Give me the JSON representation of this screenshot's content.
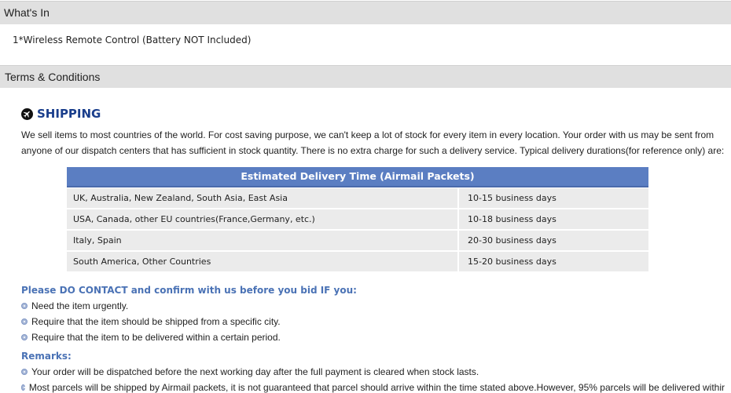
{
  "whats_in": {
    "title": "What's In",
    "item": "1*Wireless Remote Control (Battery NOT Included)"
  },
  "terms": {
    "title": "Terms & Conditions"
  },
  "shipping": {
    "icon": "airplane-icon",
    "title": "SHIPPING",
    "intro_line1": "We sell items to most countries of the world. For cost saving purpose, we can't keep a lot of stock for every item in every location. Your order with us may be sent from",
    "intro_line2": "anyone of our dispatch centers that has sufficient in stock quantity. There is no extra charge for such a delivery service. Typical delivery durations(for reference only) are:"
  },
  "delivery_table": {
    "header": "Estimated Delivery Time (Airmail Packets)",
    "rows": [
      {
        "region": "UK, Australia, New Zealand, South Asia, East Asia",
        "time": "10-15 business days"
      },
      {
        "region": "USA, Canada, other EU countries(France,Germany, etc.)",
        "time": "10-18 business days"
      },
      {
        "region": "Italy, Spain",
        "time": "20-30 business days"
      },
      {
        "region": "South America, Other Countries",
        "time": "15-20 business days"
      }
    ]
  },
  "contact": {
    "heading": "Please DO CONTACT and confirm with us before you bid IF you:",
    "items": [
      "Need the item urgently.",
      "Require that the item should be shipped from a specific city.",
      "Require that the item to be delivered within a certain period."
    ]
  },
  "remarks": {
    "heading": "Remarks:",
    "items": [
      "Your order will be dispatched before the next working day after the full payment is cleared when stock lasts.",
      "Most parcels will be shipped by Airmail packets, it is not guaranteed that parcel should arrive within the time stated above.However, 95% parcels will be delivered withir"
    ]
  },
  "colors": {
    "section_bar": "#e0e0e0",
    "shipping_title": "#1a3e8c",
    "table_header": "#5b7ec2",
    "table_row": "#ebebeb",
    "blue_heading": "#4a72b5"
  }
}
